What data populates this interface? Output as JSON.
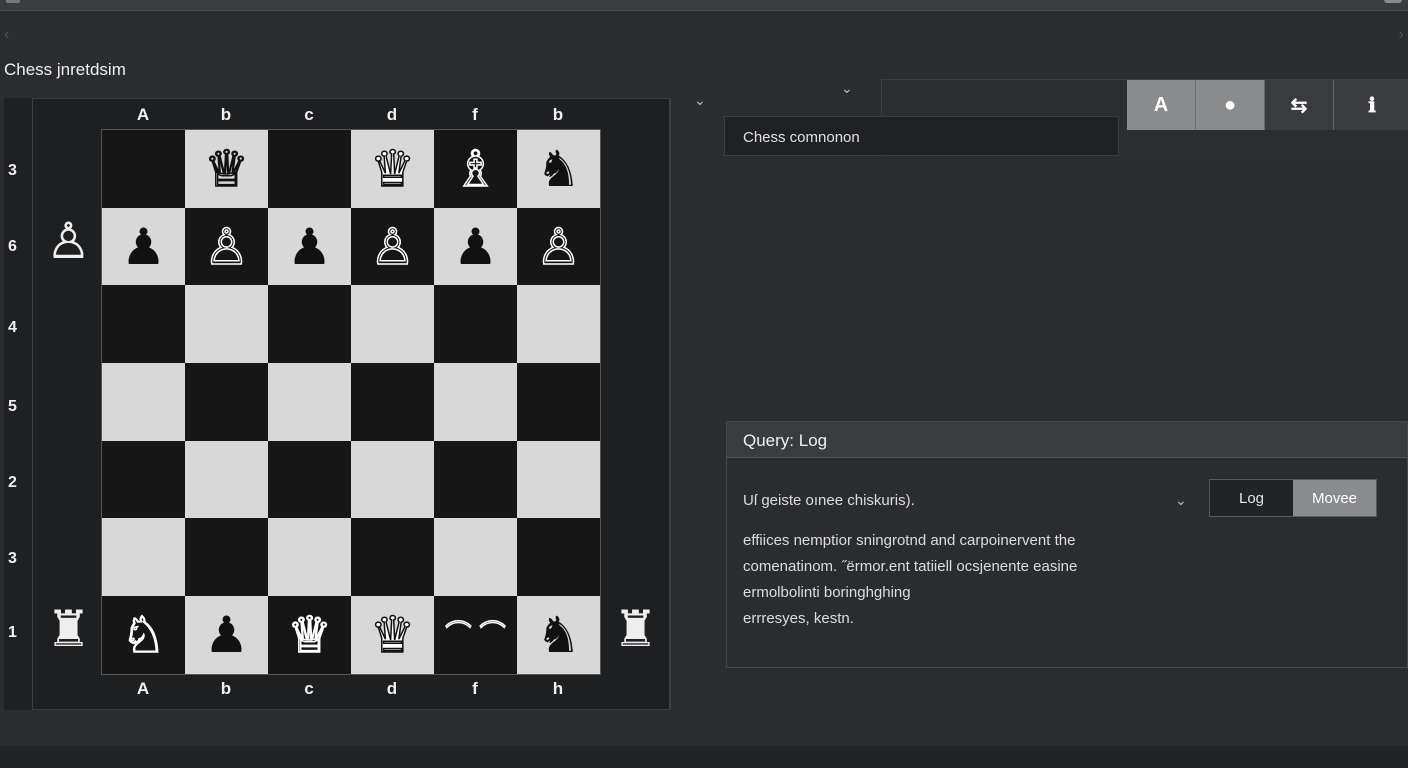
{
  "window": {
    "app_title": "Chess jnretdsim"
  },
  "board": {
    "files_top": [
      "A",
      "b",
      "c",
      "d",
      "f",
      "b"
    ],
    "files_bottom": [
      "A",
      "b",
      "c",
      "d",
      "f",
      "h"
    ],
    "ranks": [
      "3",
      "6",
      "4",
      "5",
      "2",
      "3",
      "1"
    ],
    "squares": [
      [
        {
          "p": ""
        },
        {
          "p": "♕",
          "c": "white"
        },
        {
          "p": ""
        },
        {
          "p": "♛",
          "c": "white"
        },
        {
          "p": "♗",
          "c": "white"
        },
        {
          "p": "♞",
          "c": "black"
        }
      ],
      [
        {
          "p": "♟",
          "c": "black"
        },
        {
          "p": "♙",
          "c": "white"
        },
        {
          "p": "♟",
          "c": "black"
        },
        {
          "p": "♙",
          "c": "white"
        },
        {
          "p": "♟",
          "c": "black"
        },
        {
          "p": "♙",
          "c": "white"
        }
      ],
      [
        {
          "p": ""
        },
        {
          "p": ""
        },
        {
          "p": ""
        },
        {
          "p": ""
        },
        {
          "p": ""
        },
        {
          "p": ""
        }
      ],
      [
        {
          "p": ""
        },
        {
          "p": ""
        },
        {
          "p": ""
        },
        {
          "p": ""
        },
        {
          "p": ""
        },
        {
          "p": ""
        }
      ],
      [
        {
          "p": ""
        },
        {
          "p": ""
        },
        {
          "p": ""
        },
        {
          "p": ""
        },
        {
          "p": ""
        },
        {
          "p": ""
        }
      ],
      [
        {
          "p": ""
        },
        {
          "p": ""
        },
        {
          "p": ""
        },
        {
          "p": ""
        },
        {
          "p": ""
        },
        {
          "p": ""
        }
      ],
      [
        {
          "p": "♘",
          "c": "white"
        },
        {
          "p": "♟",
          "c": "black"
        },
        {
          "p": "♕",
          "c": "white"
        },
        {
          "p": "♛",
          "c": "white"
        },
        {
          "p": "⌒ ⌒",
          "c": "white",
          "special": true
        },
        {
          "p": "♞",
          "c": "black"
        }
      ]
    ],
    "outside_left": [
      "♙",
      "♜"
    ],
    "outside_right": [
      "♜"
    ]
  },
  "toolbar": {
    "buttons": [
      {
        "name": "toolbar-a-button",
        "glyph": "A",
        "icon": "letter-a-icon",
        "dark": false
      },
      {
        "name": "toolbar-timer-button",
        "glyph": "●",
        "icon": "timer-icon",
        "dark": false
      },
      {
        "name": "toolbar-flip-button",
        "glyph": "⇆",
        "icon": "flip-icon",
        "dark": true
      },
      {
        "name": "toolbar-info-button",
        "glyph": "ℹ",
        "icon": "info-icon",
        "dark": true
      }
    ]
  },
  "search": {
    "value": "Chess comnonon"
  },
  "log": {
    "header": "Query: Log",
    "select_value": "Uſ geiste oınee chiskuris).",
    "tabs": [
      "Log",
      "Movee"
    ],
    "active_tab": 1,
    "lines": [
      "effiices nemptior sningrotnd and carpoinervent the",
      "comenatinom. ˝ërmor.ent tatiiell ocsjenente easine",
      "ermolbolinti boringhghing",
      "errresyes, kestn."
    ]
  },
  "colors": {
    "light_square": "#d8d8d8",
    "dark_square": "#161616",
    "toolbar_active": "#8a8b8d"
  }
}
